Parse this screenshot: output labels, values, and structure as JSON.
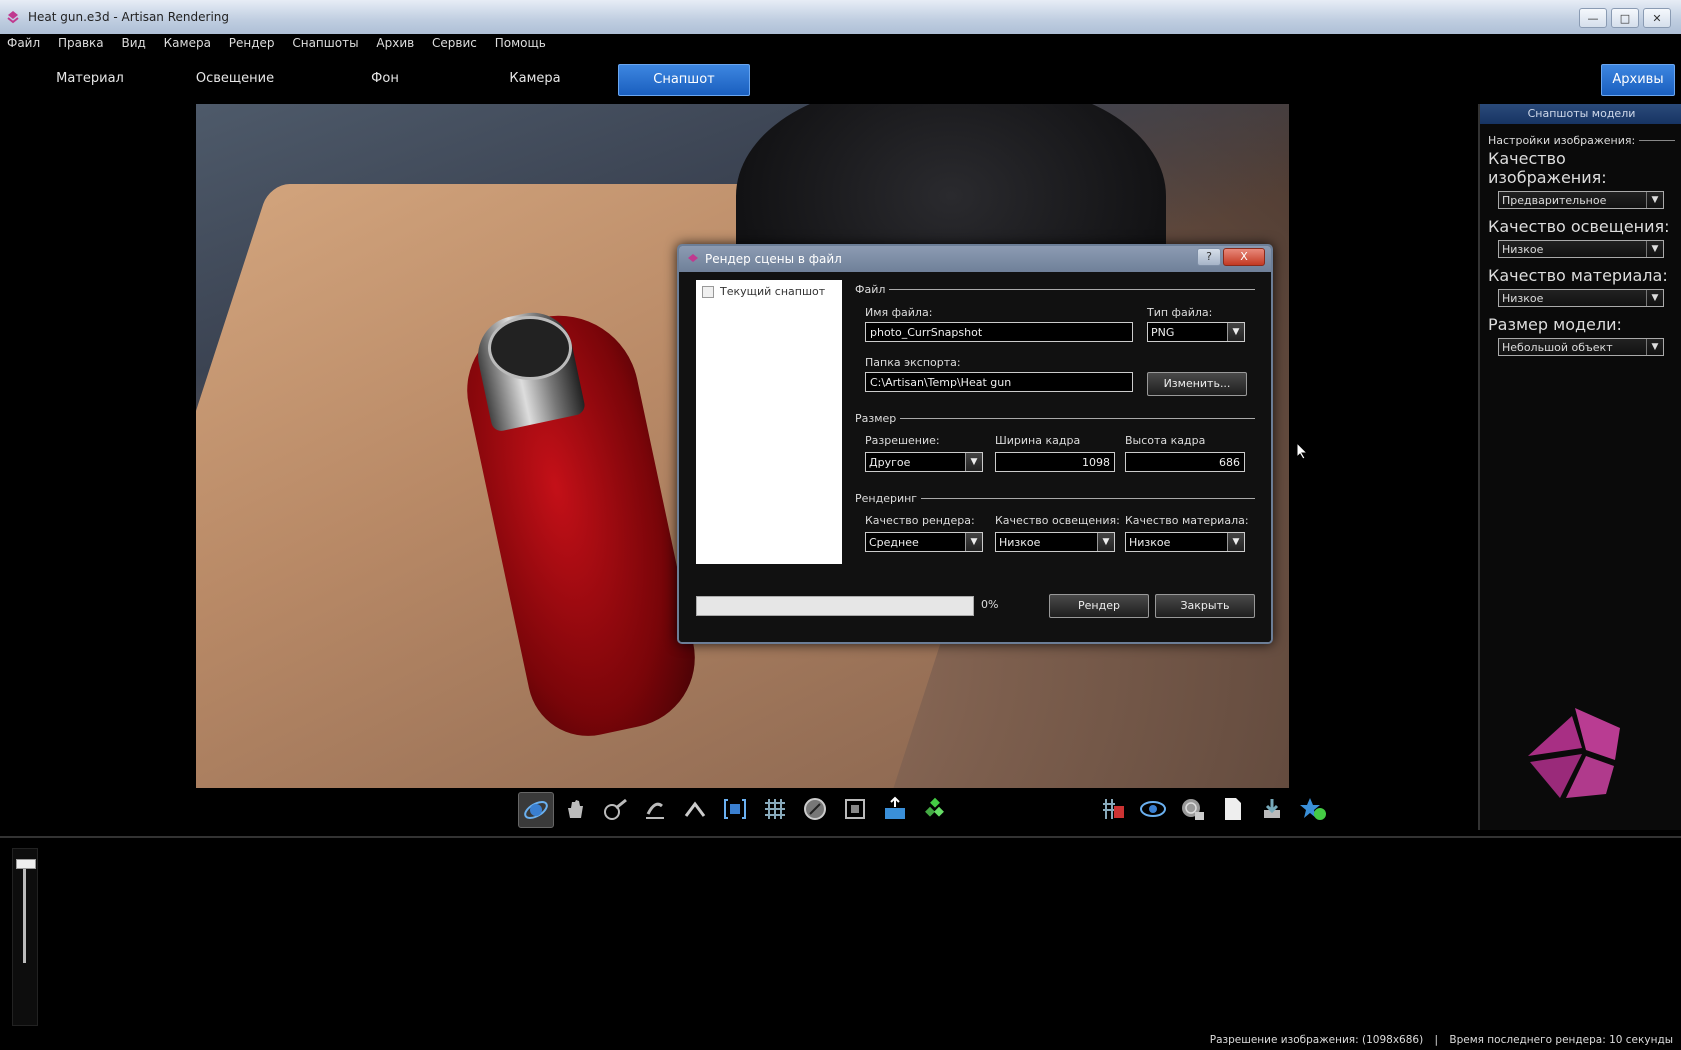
{
  "window": {
    "title": "Heat gun.e3d - Artisan Rendering",
    "controls": [
      "—",
      "□",
      "✕"
    ]
  },
  "menu": [
    "Файл",
    "Правка",
    "Вид",
    "Камера",
    "Рендер",
    "Снапшоты",
    "Архив",
    "Сервис",
    "Помощь"
  ],
  "modes": {
    "material": "Материал",
    "lighting": "Освещение",
    "background": "Фон",
    "camera": "Камера",
    "snapshot": "Снапшот",
    "archive": "Архивы"
  },
  "right_panel": {
    "header": "Снапшоты модели",
    "group_title": "Настройки изображения:",
    "image_quality_label": "Качество изображения:",
    "image_quality_value": "Предварительное",
    "lighting_quality_label": "Качество освещения:",
    "lighting_quality_value": "Низкое",
    "material_quality_label": "Качество материала:",
    "material_quality_value": "Низкое",
    "model_size_label": "Размер модели:",
    "model_size_value": "Небольшой объект"
  },
  "dialog": {
    "title": "Рендер сцены в файл",
    "help": "?",
    "close": "X",
    "snapshots": [
      "Текущий снапшот"
    ],
    "file_section": "Файл",
    "filename_label": "Имя файла:",
    "filename_value": "photo_CurrSnapshot",
    "filetype_label": "Тип файла:",
    "filetype_value": "PNG",
    "export_folder_label": "Папка экспорта:",
    "export_folder_value": "C:\\Artisan\\Temp\\Heat gun",
    "change_button": "Изменить...",
    "size_section": "Размер",
    "resolution_label": "Разрешение:",
    "resolution_value": "Другое",
    "width_label": "Ширина кадра",
    "width_value": "1098",
    "height_label": "Высота кадра",
    "height_value": "686",
    "render_section": "Рендеринг",
    "render_quality_label": "Качество рендера:",
    "render_quality_value": "Среднее",
    "light_quality_label": "Качество освещения:",
    "light_quality_value": "Низкое",
    "mat_quality_label": "Качество материала:",
    "mat_quality_value": "Низкое",
    "progress": 0,
    "progress_text": "0%",
    "render_button": "Рендер",
    "close_button": "Закрыть"
  },
  "statusbar": {
    "resolution": "Разрешение изображения: (1098x686)",
    "separator": "|",
    "last_render": "Время последнего рендера: 10 секунды"
  },
  "colors": {
    "accent": "#1a5fbf",
    "heatgun": "#a00a12",
    "logo": "#b0388f"
  }
}
